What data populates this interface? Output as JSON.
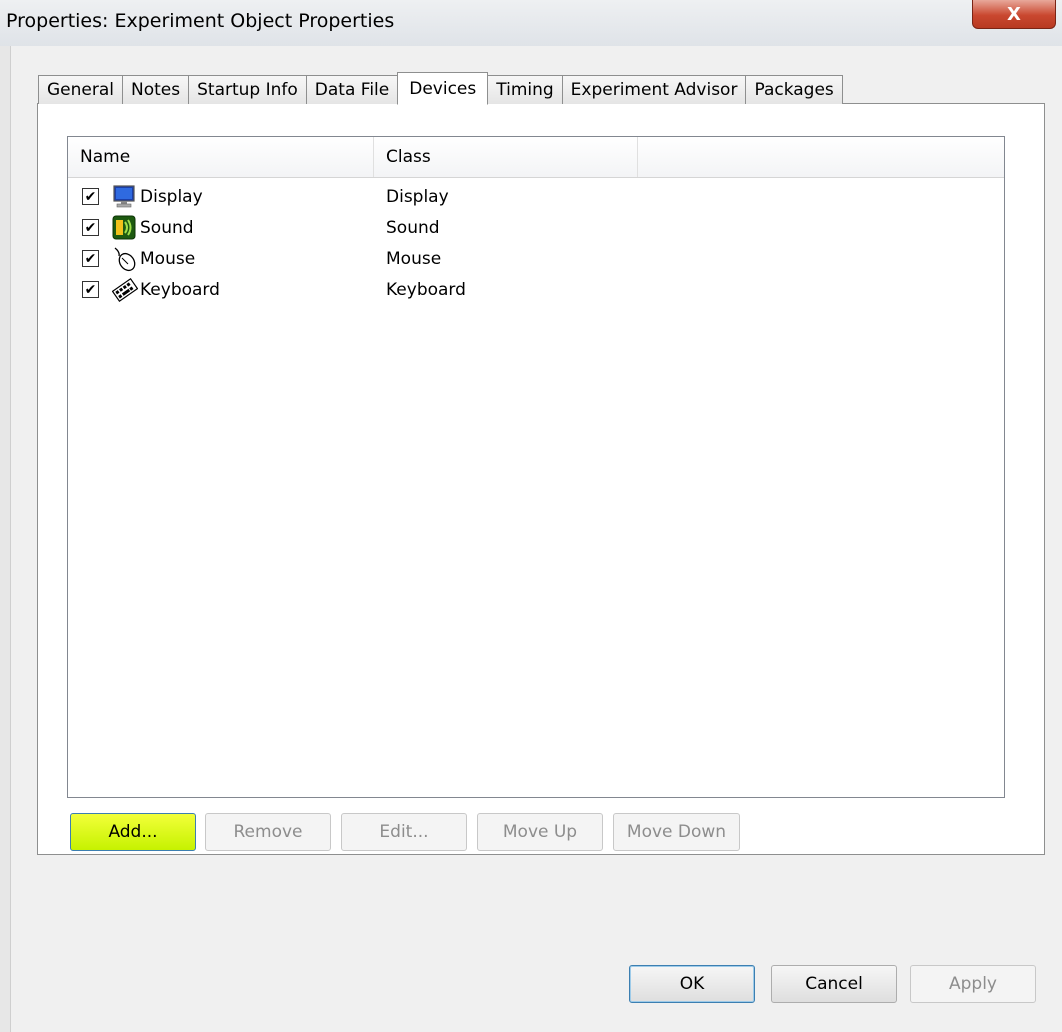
{
  "window": {
    "title": "Properties: Experiment Object Properties",
    "close_glyph": "X"
  },
  "tabs": [
    {
      "label": "General",
      "active": false
    },
    {
      "label": "Notes",
      "active": false
    },
    {
      "label": "Startup Info",
      "active": false
    },
    {
      "label": "Data File",
      "active": false
    },
    {
      "label": "Devices",
      "active": true
    },
    {
      "label": "Timing",
      "active": false
    },
    {
      "label": "Experiment Advisor",
      "active": false
    },
    {
      "label": "Packages",
      "active": false
    }
  ],
  "list": {
    "columns": [
      "Name",
      "Class",
      ""
    ],
    "rows": [
      {
        "name": "Display",
        "class": "Display",
        "checked": true,
        "icon": "display-icon"
      },
      {
        "name": "Sound",
        "class": "Sound",
        "checked": true,
        "icon": "sound-icon"
      },
      {
        "name": "Mouse",
        "class": "Mouse",
        "checked": true,
        "icon": "mouse-icon"
      },
      {
        "name": "Keyboard",
        "class": "Keyboard",
        "checked": true,
        "icon": "keyboard-icon"
      }
    ],
    "check_glyph": "✔"
  },
  "panel_buttons": {
    "add": "Add...",
    "remove": "Remove",
    "edit": "Edit...",
    "move_up": "Move Up",
    "move_down": "Move Down"
  },
  "dialog_buttons": {
    "ok": "OK",
    "cancel": "Cancel",
    "apply": "Apply"
  },
  "colors": {
    "add_highlight": "#d4f700",
    "close_red": "#c9472f",
    "focus_border": "#3c7fb1"
  }
}
